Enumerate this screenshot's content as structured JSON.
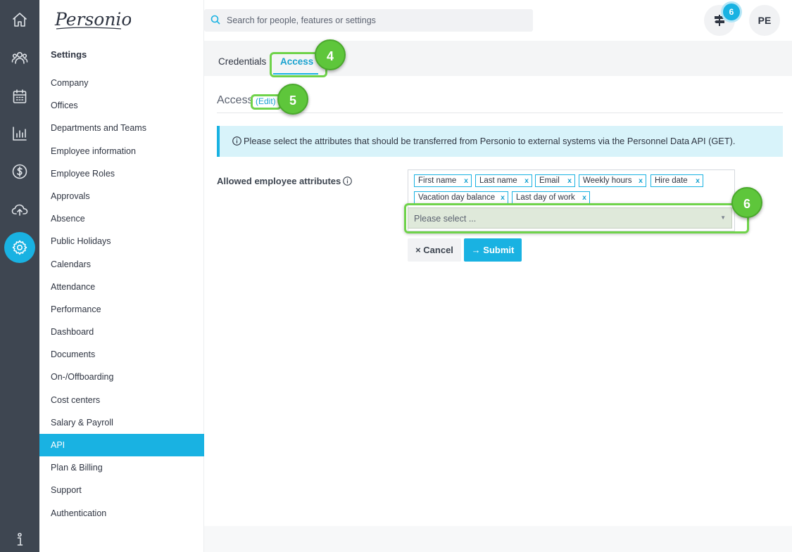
{
  "brand": {
    "logo_text": "Personio",
    "accent": "#19b2e2",
    "rail_bg": "#3e4651",
    "highlight": "#6fd34a"
  },
  "rail": {
    "items": [
      {
        "icon": "home-icon"
      },
      {
        "icon": "people-icon"
      },
      {
        "icon": "calendar-icon"
      },
      {
        "icon": "bar-chart-icon"
      },
      {
        "icon": "dollar-icon"
      },
      {
        "icon": "cloud-upload-icon"
      },
      {
        "icon": "gear-icon",
        "active": true
      },
      {
        "icon": "info-person-icon"
      }
    ]
  },
  "search": {
    "placeholder": "Search for people, features or settings"
  },
  "header": {
    "notifications_count": "6",
    "avatar_initials": "PE"
  },
  "settings": {
    "title": "Settings",
    "items": [
      "Company",
      "Offices",
      "Departments and Teams",
      "Employee information",
      "Employee Roles",
      "Approvals",
      "Absence",
      "Public Holidays",
      "Calendars",
      "Attendance",
      "Performance",
      "Dashboard",
      "Documents",
      "On-/Offboarding",
      "Cost centers",
      "Salary & Payroll",
      "API",
      "Plan & Billing",
      "Support",
      "Authentication"
    ],
    "active": "API"
  },
  "tabs": {
    "credentials": "Credentials",
    "access": "Access"
  },
  "section": {
    "title": "Access",
    "edit": "(Edit)"
  },
  "info": {
    "text": "Please select the attributes that should be transferred from Personio to external systems via the Personnel Data API (GET)."
  },
  "form": {
    "label": "Allowed employee attributes",
    "tags": [
      "First name",
      "Last name",
      "Email",
      "Weekly hours",
      "Hire date",
      "Vacation day balance",
      "Last day of work"
    ],
    "tag_remove": "x",
    "select_placeholder": "Please select ...",
    "cancel": "Cancel",
    "cancel_icon": "×",
    "submit": "Submit",
    "submit_icon": "→"
  },
  "steps": {
    "access_tab": "4",
    "edit_link": "5",
    "select_field": "6"
  }
}
